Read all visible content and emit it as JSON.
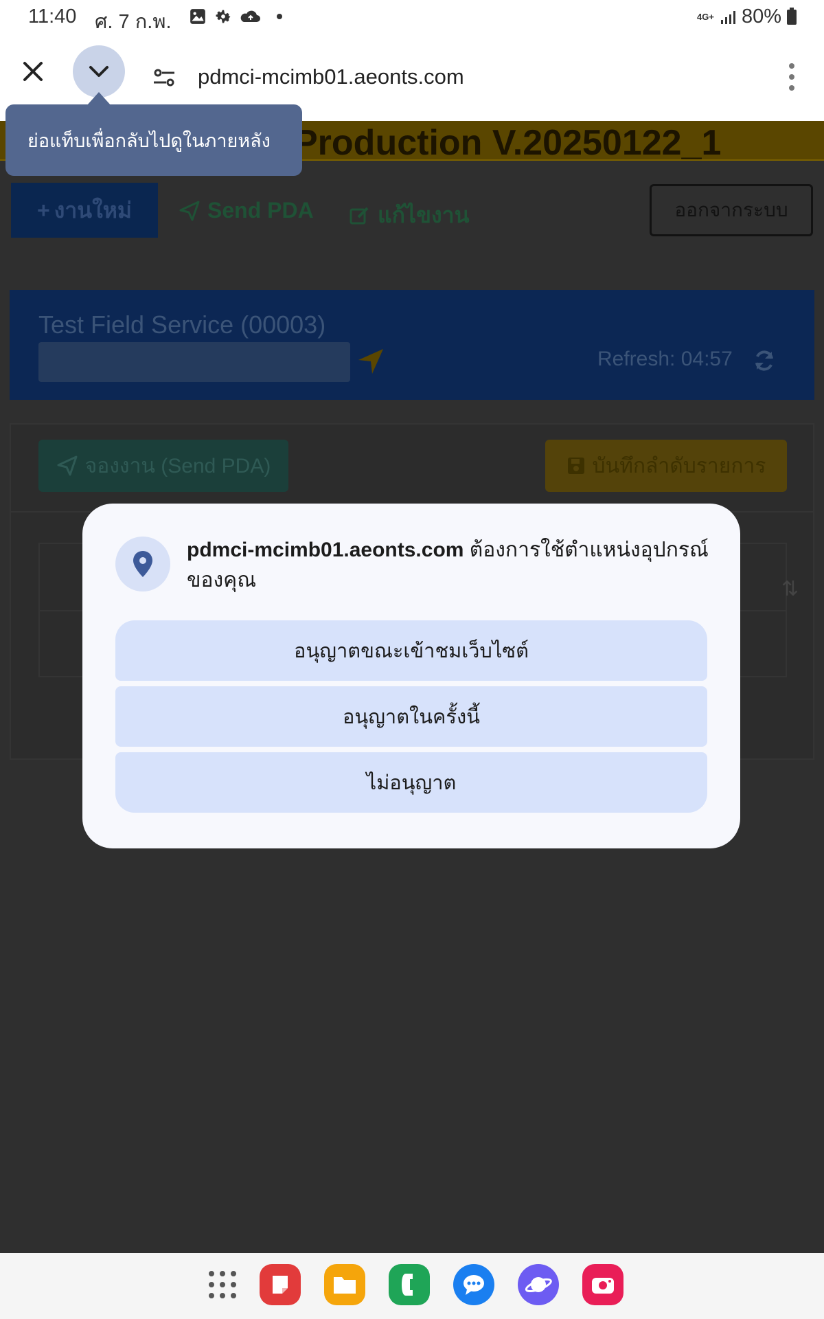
{
  "status_bar": {
    "time": "11:40",
    "date": "ศ. 7 ก.พ.",
    "network": "4G+",
    "battery": "80%"
  },
  "browser": {
    "url": "pdmci-mcimb01.aeonts.com",
    "tooltip": "ย่อแท็บเพื่อกลับไปดูในภายหลัง",
    "icons": {
      "close": "close-icon",
      "minimize": "chevron-down-icon",
      "site_settings": "tune-icon",
      "menu": "more-vert-icon"
    }
  },
  "page": {
    "banner": "Production V.20250122_1",
    "nav": {
      "new_job": "งานใหม่",
      "send_pda": "Send PDA",
      "edit_job": "แก้ไขงาน",
      "logout": "ออกจากระบบ"
    },
    "service": {
      "title": "Test Field Service (00003)",
      "refresh": "Refresh: 04:57"
    },
    "actions": {
      "reserve": "จองงาน (Send PDA)",
      "save_order": "บันทึกลำดับรายการ"
    }
  },
  "dialog": {
    "domain": "pdmci-mcimb01.aeonts.com",
    "message": " ต้องการใช้ตำแหน่งอุปกรณ์ของคุณ",
    "buttons": {
      "allow_while_visiting": "อนุญาตขณะเข้าชมเว็บไซต์",
      "allow_once": "อนุญาตในครั้งนี้",
      "deny": "ไม่อนุญาต"
    }
  },
  "colors": {
    "dialog_button": "#d7e2fb",
    "tooltip": "#53678f",
    "page_dim": "#2f2f2f"
  }
}
